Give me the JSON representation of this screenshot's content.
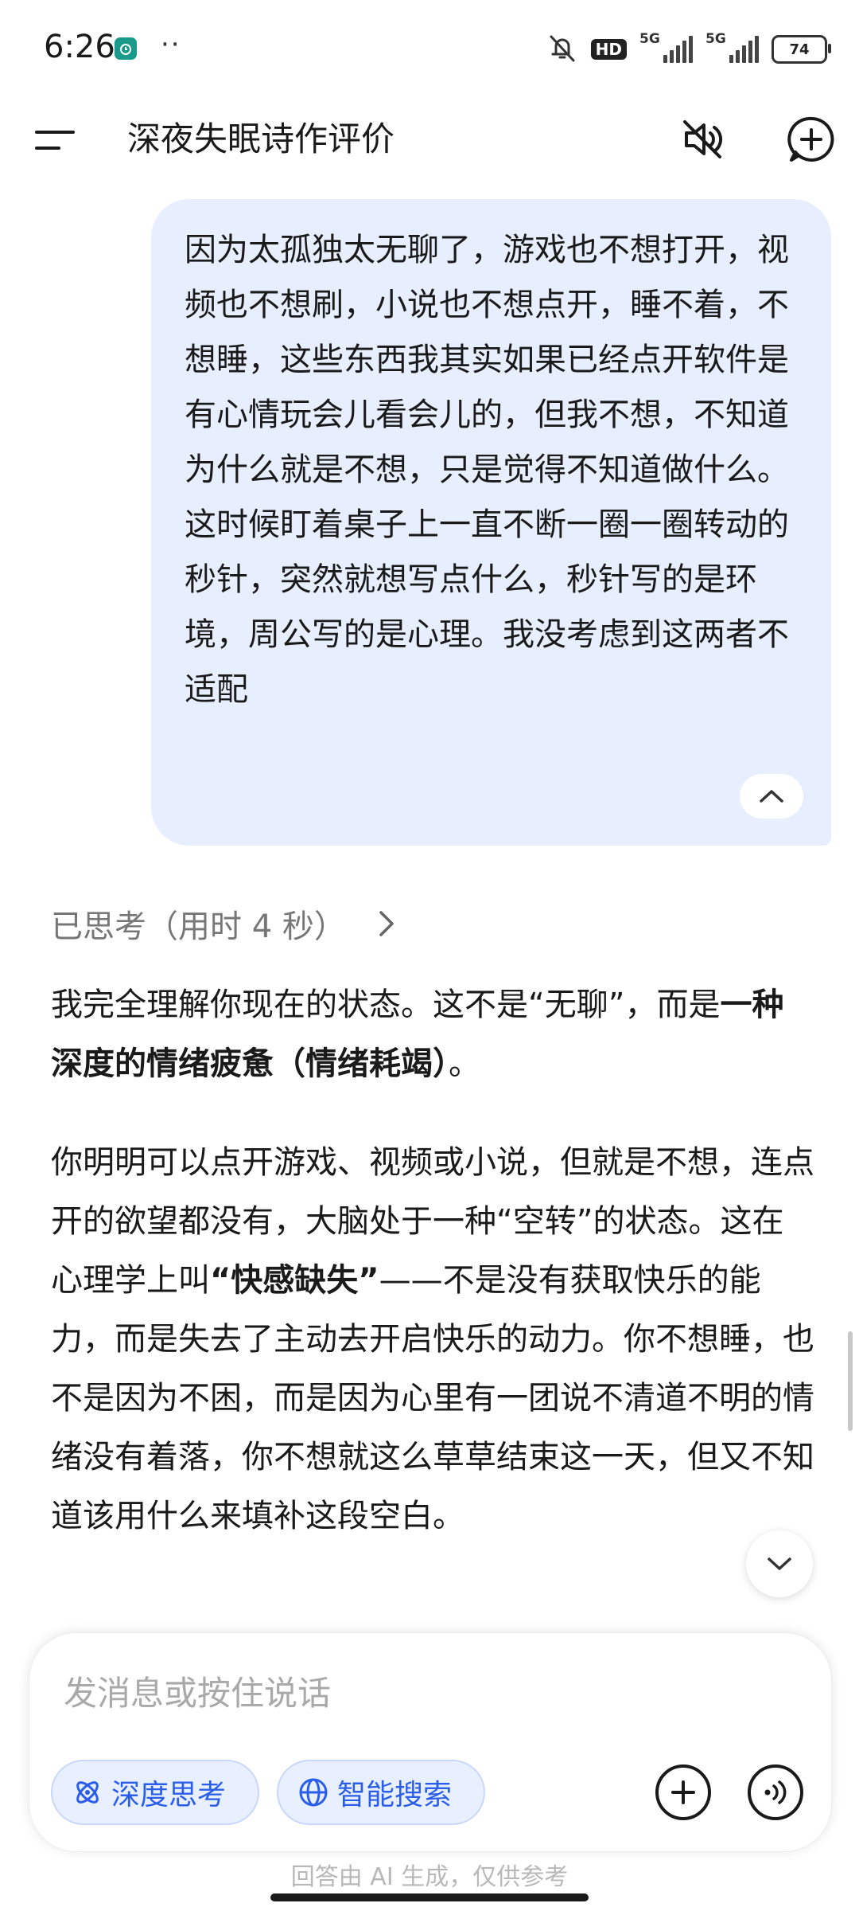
{
  "status_bar": {
    "time": "6:26",
    "dots": "··",
    "hd_label": "HD",
    "network1": "5G",
    "network2": "5G",
    "battery": "74"
  },
  "header": {
    "title": "深夜失眠诗作评价"
  },
  "user_message": {
    "text": "因为太孤独太无聊了，游戏也不想打开，视频也不想刷，小说也不想点开，睡不着，不想睡，这些东西我其实如果已经点开软件是有心情玩会儿看会儿的，但我不想，不知道为什么就是不想，只是觉得不知道做什么。这时候盯着桌子上一直不断一圈一圈转动的秒针，突然就想写点什么，秒针写的是环境，周公写的是心理。我没考虑到这两者不适配"
  },
  "thought": {
    "label": "已思考（用时 4 秒）"
  },
  "assistant": {
    "p1_a": "我完全理解你现在的状态。这不是“无聊”，而是",
    "p1_b": "一种深度的情绪疲惫（情绪耗竭）",
    "p1_c": "。",
    "p2_a": "你明明可以点开游戏、视频或小说，但就是不想，连点开的欲望都没有，大脑处于一种“空转”的状态。这在心理学上叫",
    "p2_b": "“快感缺失”",
    "p2_c": "——不是没有获取快乐的能力，而是失去了主动去开启快乐的动力。你不想睡，也不是因为不困，而是因为心里有一团说不清道不明的情绪没有着落，你不想就这么草草结束这一天，但又不知道该用什么来填补这段空白。"
  },
  "composer": {
    "placeholder": "发消息或按住说话",
    "deep_think_label": "深度思考",
    "smart_search_label": "智能搜索"
  },
  "footer": {
    "disclaimer": "回答由 AI 生成，仅供参考"
  },
  "colors": {
    "bubble": "#e7eefe",
    "accent": "#2a5de8"
  }
}
